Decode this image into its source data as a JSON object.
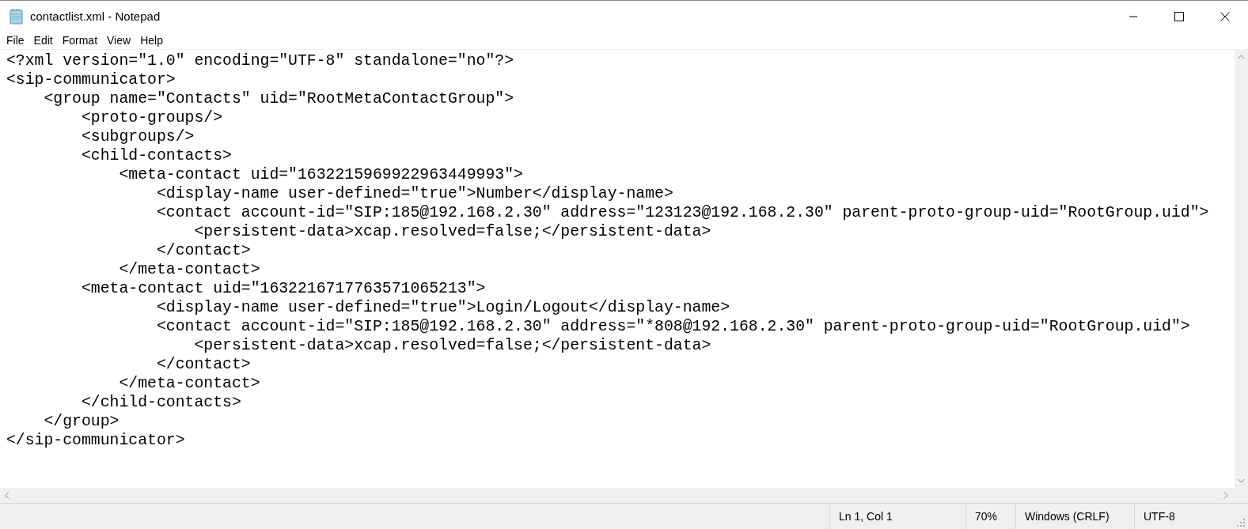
{
  "window": {
    "title": "contactlist.xml - Notepad"
  },
  "menu": [
    "File",
    "Edit",
    "Format",
    "View",
    "Help"
  ],
  "editor": {
    "lines": [
      "<?xml version=\"1.0\" encoding=\"UTF-8\" standalone=\"no\"?>",
      "<sip-communicator>",
      "    <group name=\"Contacts\" uid=\"RootMetaContactGroup\">",
      "        <proto-groups/>",
      "        <subgroups/>",
      "        <child-contacts>",
      "            <meta-contact uid=\"1632215969922963449993\">",
      "                <display-name user-defined=\"true\">Number</display-name>",
      "                <contact account-id=\"SIP:185@192.168.2.30\" address=\"123123@192.168.2.30\" parent-proto-group-uid=\"RootGroup.uid\">",
      "                    <persistent-data>xcap.resolved=false;</persistent-data>",
      "                </contact>",
      "            </meta-contact>",
      "        <meta-contact uid=\"1632216717763571065213\">",
      "                <display-name user-defined=\"true\">Login/Logout</display-name>",
      "                <contact account-id=\"SIP:185@192.168.2.30\" address=\"*808@192.168.2.30\" parent-proto-group-uid=\"RootGroup.uid\">",
      "                    <persistent-data>xcap.resolved=false;</persistent-data>",
      "                </contact>",
      "            </meta-contact>",
      "        </child-contacts>",
      "    </group>",
      "</sip-communicator>"
    ]
  },
  "status_bar": [
    "Ln 1, Col 1",
    "70%",
    "Windows (CRLF)",
    "UTF-8"
  ]
}
